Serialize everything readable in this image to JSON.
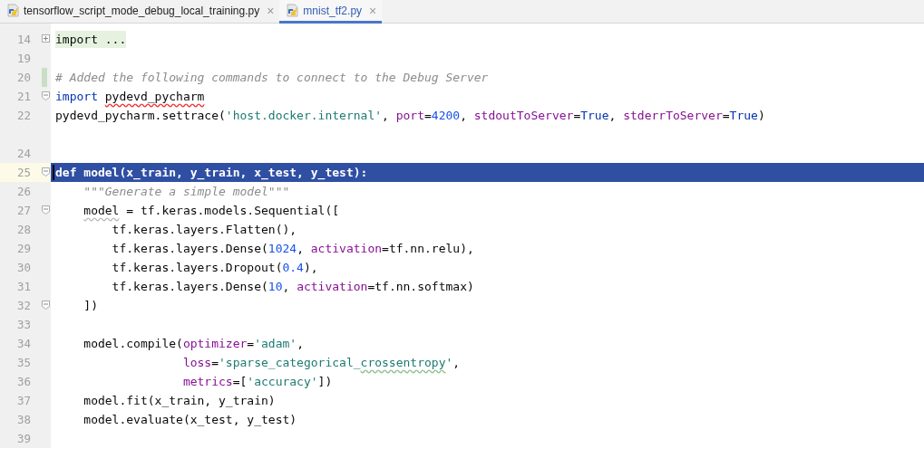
{
  "tabs": [
    {
      "label": "tensorflow_script_mode_debug_local_training.py",
      "close": "×",
      "selected": false
    },
    {
      "label": "mnist_tf2.py",
      "close": "×",
      "selected": true
    }
  ],
  "lines": [
    {
      "number": "14",
      "fold": {
        "collapsed": true
      },
      "selected": false,
      "changed": false,
      "tokens": [
        {
          "kind": "folded",
          "text": "import ..."
        }
      ]
    },
    {
      "number": "19",
      "selected": false,
      "changed": false
    },
    {
      "number": "20",
      "selected": false,
      "changed": true,
      "tokens": [
        {
          "kind": "comment",
          "text": "# Added the following commands to connect to the Debug Server"
        }
      ]
    },
    {
      "number": "21",
      "fold": {
        "collapsed": false
      },
      "selected": false,
      "changed": false,
      "tokens": [
        {
          "kind": "keyword",
          "text": "import "
        },
        {
          "kind": "plain",
          "text": "pydevd_pycharm",
          "squiggle": {
            "kind": "error"
          }
        }
      ]
    },
    {
      "number": "22",
      "selected": false,
      "changed": false,
      "tokens": [
        {
          "kind": "plain",
          "text": "pydevd_pycharm.settrace("
        },
        {
          "kind": "string",
          "text": "'host.docker.internal'"
        },
        {
          "kind": "plain",
          "text": ", "
        },
        {
          "kind": "param",
          "text": "port"
        },
        {
          "kind": "plain",
          "text": "="
        },
        {
          "kind": "number",
          "text": "4200"
        },
        {
          "kind": "plain",
          "text": ", "
        },
        {
          "kind": "param",
          "text": "stdoutToServer"
        },
        {
          "kind": "plain",
          "text": "="
        },
        {
          "kind": "keyword",
          "text": "True"
        },
        {
          "kind": "plain",
          "text": ", "
        },
        {
          "kind": "param",
          "text": "stderrToServer"
        },
        {
          "kind": "plain",
          "text": "="
        },
        {
          "kind": "keyword",
          "text": "True"
        },
        {
          "kind": "plain",
          "text": ")"
        }
      ]
    },
    {
      "selected": false,
      "changed": false
    },
    {
      "number": "24",
      "selected": false,
      "changed": false
    },
    {
      "number": "25",
      "fold": {
        "collapsed": false
      },
      "selected": true,
      "changed": false,
      "tokens": [
        {
          "kind": "keyword",
          "text": "def "
        },
        {
          "kind": "plain",
          "text": "model(x_train, y_train, x_test, y_test):"
        }
      ]
    },
    {
      "number": "26",
      "selected": false,
      "changed": false,
      "tokens": [
        {
          "kind": "doc",
          "text": "    \"\"\"Generate a simple model\"\"\""
        }
      ]
    },
    {
      "number": "27",
      "fold": {
        "collapsed": false
      },
      "selected": false,
      "changed": false,
      "tokens": [
        {
          "kind": "plain",
          "text": "    model",
          "squiggle": {
            "kind": "weak"
          }
        },
        {
          "kind": "plain",
          "text": " = tf.keras.models.Sequential(["
        }
      ]
    },
    {
      "number": "28",
      "selected": false,
      "changed": false,
      "tokens": [
        {
          "kind": "plain",
          "text": "        tf.keras.layers.Flatten(),"
        }
      ]
    },
    {
      "number": "29",
      "selected": false,
      "changed": false,
      "tokens": [
        {
          "kind": "plain",
          "text": "        tf.keras.layers.Dense("
        },
        {
          "kind": "number",
          "text": "1024"
        },
        {
          "kind": "plain",
          "text": ", "
        },
        {
          "kind": "param",
          "text": "activation"
        },
        {
          "kind": "plain",
          "text": "=tf.nn.relu),"
        }
      ]
    },
    {
      "number": "30",
      "selected": false,
      "changed": false,
      "tokens": [
        {
          "kind": "plain",
          "text": "        tf.keras.layers.Dropout("
        },
        {
          "kind": "number",
          "text": "0.4"
        },
        {
          "kind": "plain",
          "text": "),"
        }
      ]
    },
    {
      "number": "31",
      "selected": false,
      "changed": false,
      "tokens": [
        {
          "kind": "plain",
          "text": "        tf.keras.layers.Dense("
        },
        {
          "kind": "number",
          "text": "10"
        },
        {
          "kind": "plain",
          "text": ", "
        },
        {
          "kind": "param",
          "text": "activation"
        },
        {
          "kind": "plain",
          "text": "=tf.nn.softmax)"
        }
      ]
    },
    {
      "number": "32",
      "fold": {
        "collapsed": false
      },
      "selected": false,
      "changed": false,
      "tokens": [
        {
          "kind": "plain",
          "text": "    ])"
        }
      ]
    },
    {
      "number": "33",
      "selected": false,
      "changed": false
    },
    {
      "number": "34",
      "selected": false,
      "changed": false,
      "tokens": [
        {
          "kind": "plain",
          "text": "    model.compile("
        },
        {
          "kind": "param",
          "text": "optimizer"
        },
        {
          "kind": "plain",
          "text": "="
        },
        {
          "kind": "string",
          "text": "'adam'"
        },
        {
          "kind": "plain",
          "text": ","
        }
      ]
    },
    {
      "number": "35",
      "selected": false,
      "changed": false,
      "tokens": [
        {
          "kind": "param",
          "text": "                  loss"
        },
        {
          "kind": "plain",
          "text": "="
        },
        {
          "kind": "string",
          "text": "'sparse_categorical_"
        },
        {
          "kind": "string",
          "text": "crossentropy",
          "squiggle": {
            "kind": "typo"
          }
        },
        {
          "kind": "string",
          "text": "'"
        },
        {
          "kind": "plain",
          "text": ","
        }
      ]
    },
    {
      "number": "36",
      "selected": false,
      "changed": false,
      "tokens": [
        {
          "kind": "param",
          "text": "                  metrics"
        },
        {
          "kind": "plain",
          "text": "=["
        },
        {
          "kind": "string",
          "text": "'accuracy'"
        },
        {
          "kind": "plain",
          "text": "])"
        }
      ]
    },
    {
      "number": "37",
      "selected": false,
      "changed": false,
      "tokens": [
        {
          "kind": "plain",
          "text": "    model.fit(x_train, y_train)"
        }
      ]
    },
    {
      "number": "38",
      "selected": false,
      "changed": false,
      "tokens": [
        {
          "kind": "plain",
          "text": "    model.evaluate(x_test, y_test)"
        }
      ]
    },
    {
      "number": "39",
      "selected": false,
      "changed": false
    }
  ]
}
